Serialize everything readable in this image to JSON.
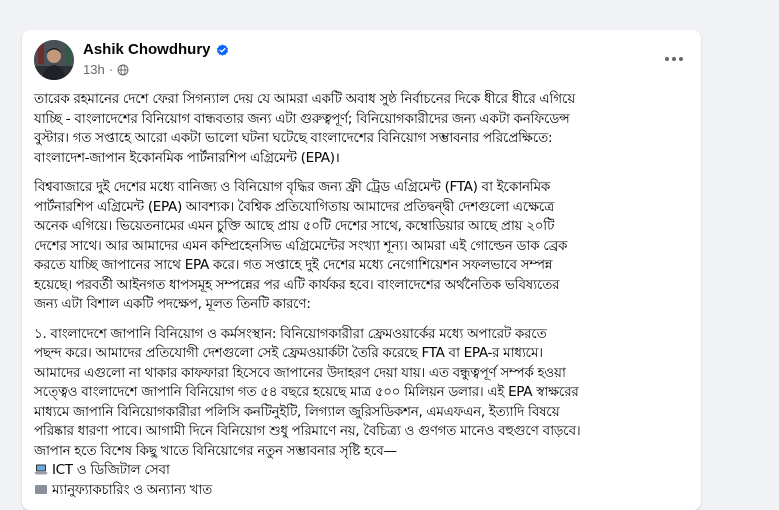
{
  "post": {
    "author_name": "Ashik Chowdhury",
    "time": "13h",
    "separator": "·",
    "icons": {
      "verified": "verified-badge-icon",
      "audience": "globe-icon",
      "more": "more-options-icon",
      "laptop": "laptop-emoji-icon"
    },
    "colors": {
      "verified": "#0866ff",
      "meta_text": "#65676b",
      "body_text": "#050505"
    },
    "paragraphs": [
      {
        "lines": [
          "তারেক রহমানের দেশে ফেরা সিগন্যাল দেয় যে আমরা একটি অবাধ সুষ্ঠ নির্বাচনের দিকে ধীরে ধীরে এগিয়ে",
          "যাচ্ছি - বাংলাদেশের বিনিয়োগ বান্ধবতার জন্য এটা গুরুত্বপূর্ণ; বিনিয়োগকারীদের জন্য একটা কনফিডেন্স",
          "বুস্টার। গত সপ্তাহে আরো একটা ভালো ঘটনা ঘটেছে বাংলাদেশের বিনিয়োগ সম্ভাবনার পরিপ্রেক্ষিতে:",
          "বাংলাদেশ-জাপান ইকোনমিক পার্টনারশিপ এগ্রিমেন্ট (EPA)।"
        ]
      },
      {
        "lines": [
          "বিশ্ববাজারে দুই দেশের মধ্যে বানিজ্য ও বিনিয়োগ বৃদ্ধির জন্য ফ্রী ট্রেড এগ্রিমেন্ট (FTA) বা ইকোনমিক",
          "পার্টনারশিপ এগ্রিমেন্ট (EPA) আবশ্যক। বৈশ্বিক প্রতিযোগিতায় আমাদের প্রতিদ্বন্দ্বী দেশগুলো এক্ষেত্রে",
          "অনেক এগিয়ে। ভিয়েতনামের এমন চুক্তি আছে প্রায় ৫০টি দেশের সাথে, কম্বোডিয়ার আছে প্রায় ২০টি",
          "দেশের সাথে। আর আমাদের এমন কম্প্রিহেনসিভ এগ্রিমেন্টের সংখ্যা শূন্য। আমরা এই গোল্ডেন ডাক ব্রেক",
          "করতে যাচ্ছি জাপানের সাথে EPA করে। গত সপ্তাহে দুই দেশের মধ্যে নেগোশিয়েশন সফলভাবে সম্পন্ন",
          "হয়েছে। পরবর্তী আইনগত ধাপসমূহ সম্পন্নের পর এটি কার্যকর হবে। বাংলাদেশের অর্থনৈতিক ভবিষ্যতের",
          "জন্য এটা বিশাল একটি পদক্ষেপ, মূলত তিনটি কারণে:"
        ]
      },
      {
        "lines": [
          "১. বাংলাদেশে জাপানি বিনিয়োগ ও কর্মসংস্থান: বিনিয়োগকারীরা ফ্রেমওয়ার্কের মধ্যে অপারেট করতে",
          "পছন্দ করে। আমাদের প্রতিযোগী দেশগুলো সেই ফ্রেমওয়ার্কটা তৈরি করেছে FTA বা EPA-র মাধ্যমে।",
          "আমাদের এগুলো না থাকার কাফফারা হিসেবে জাপানের উদাহরণ দেয়া যায়। এত বন্ধুত্বপূর্ণ সম্পর্ক হওয়া",
          "সত্ত্বেও বাংলাদেশে জাপানি বিনিয়োগ গত ৫৪ বছরে হয়েছে মাত্র ৫০০ মিলিয়ন ডলার। এই EPA স্বাক্ষরের",
          "মাধ্যমে জাপানি বিনিয়োগকারীরা পলিসি কনটিনুইটি, লিগ্যাল জুরিসডিকশন, এমএফএন, ইত্যাদি বিষয়ে",
          "পরিষ্কার ধারণা পাবে। আগামী দিনে বিনিয়োগ শুধু পরিমাণে নয়, বৈচিত্র্য ও গুণগত মানেও বহুগুণে বাড়বে।",
          "জাপান হতে বিশেষ কিছু খাতে বিনিয়োগের নতুন সম্ভাবনার সৃষ্টি হবে—"
        ]
      }
    ],
    "bullet_1": "ICT ও ডিজিটাল সেবা",
    "bullet_2_partial": "ম্যানুফ্যাকচারিং ও অন্যান্য খাত"
  }
}
